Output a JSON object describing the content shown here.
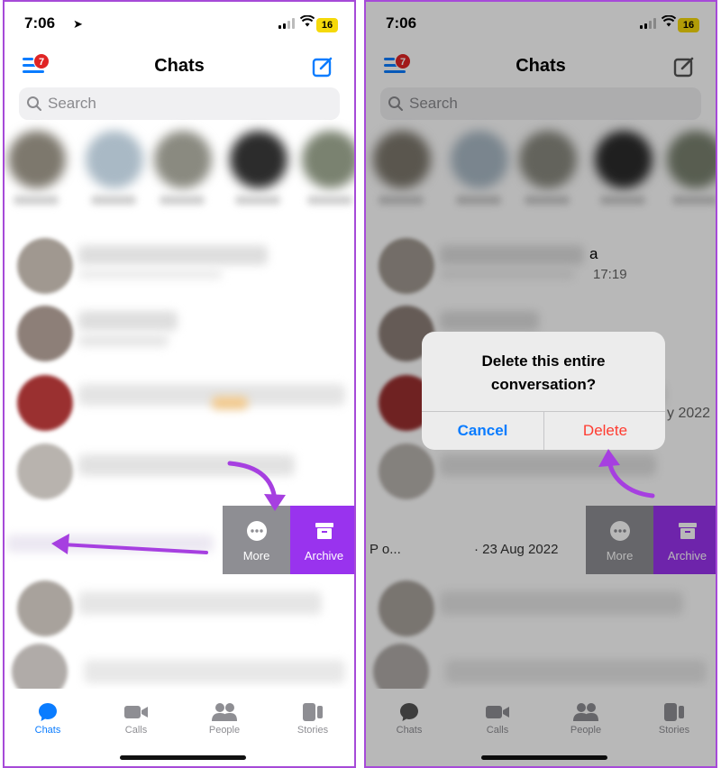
{
  "status": {
    "time": "7:06",
    "battery": "16"
  },
  "header": {
    "title": "Chats",
    "badge": "7"
  },
  "search": {
    "placeholder": "Search"
  },
  "actions": {
    "more_label": "More",
    "archive_label": "Archive"
  },
  "tabs": [
    {
      "label": "Chats"
    },
    {
      "label": "Calls"
    },
    {
      "label": "People"
    },
    {
      "label": "Stories"
    }
  ],
  "right_screen": {
    "row1_suffix": "a",
    "row1_time": "17:19",
    "row3_date": "y 2022",
    "swiped_row_text": "P  o...",
    "swiped_row_date": " · 23 Aug 2022"
  },
  "dialog": {
    "message_line1": "Delete this entire",
    "message_line2": "conversation?",
    "cancel_label": "Cancel",
    "delete_label": "Delete"
  },
  "colors": {
    "accent": "#0a7cff",
    "archive": "#9933ee",
    "more": "#8e8e93",
    "delete": "#ff3b30",
    "annotation_arrow": "#a63fe0",
    "badge": "#e02424"
  }
}
